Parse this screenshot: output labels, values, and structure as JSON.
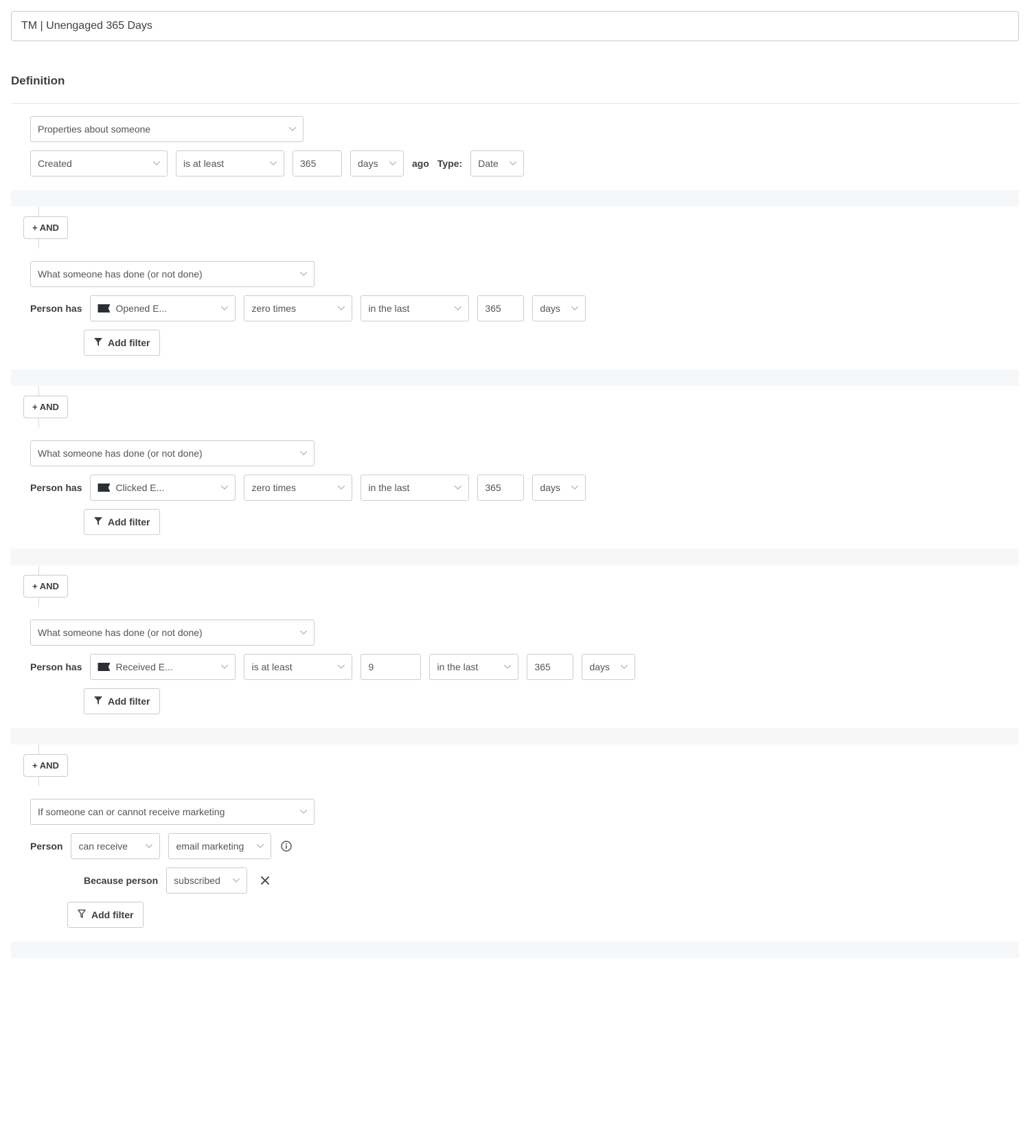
{
  "title": "TM | Unengaged 365 Days",
  "heading": "Definition",
  "labels": {
    "and": "+ AND",
    "person_has": "Person has",
    "person": "Person",
    "because_person": "Because person",
    "ago": "ago",
    "type": "Type:",
    "add_filter": "Add filter"
  },
  "groups": [
    {
      "category": "Properties about someone",
      "rows": [
        {
          "type": "property",
          "property": "Created",
          "operator": "is at least",
          "value": "365",
          "unit": "days",
          "suffix": "ago",
          "meta_label": "Type:",
          "meta_value": "Date"
        }
      ]
    },
    {
      "category": "What someone has done (or not done)",
      "rows": [
        {
          "type": "activity",
          "metric": "Opened E...",
          "operator": "zero times",
          "time_op": "in the last",
          "time_value": "365",
          "time_unit": "days"
        }
      ]
    },
    {
      "category": "What someone has done (or not done)",
      "rows": [
        {
          "type": "activity",
          "metric": "Clicked E...",
          "operator": "zero times",
          "time_op": "in the last",
          "time_value": "365",
          "time_unit": "days"
        }
      ]
    },
    {
      "category": "What someone has done (or not done)",
      "rows": [
        {
          "type": "activity_count",
          "metric": "Received E...",
          "operator": "is at least",
          "count": "9",
          "time_op": "in the last",
          "time_value": "365",
          "time_unit": "days"
        }
      ]
    },
    {
      "category": "If someone can or cannot receive marketing",
      "rows": [
        {
          "type": "consent",
          "verb": "can receive",
          "channel": "email marketing",
          "reason": "subscribed"
        }
      ]
    }
  ]
}
